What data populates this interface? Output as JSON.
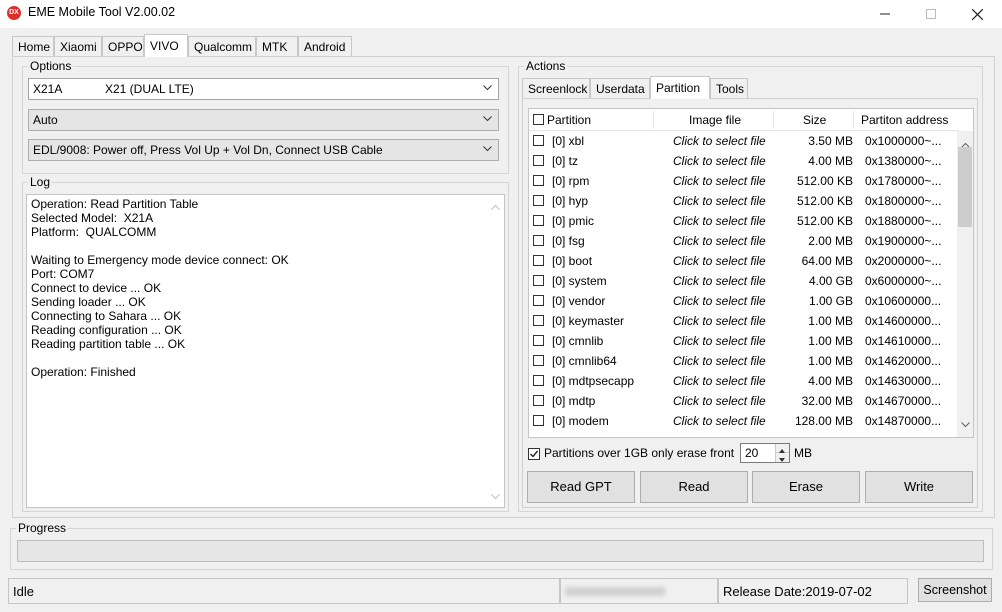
{
  "window": {
    "title": "EME Mobile Tool V2.00.02",
    "icon": "app-logo-icon",
    "icon_text": "DX"
  },
  "main_tabs": [
    {
      "label": "Home"
    },
    {
      "label": "Xiaomi"
    },
    {
      "label": "OPPO"
    },
    {
      "label": "VIVO"
    },
    {
      "label": "Qualcomm"
    },
    {
      "label": "MTK"
    },
    {
      "label": "Android"
    }
  ],
  "main_tabs_active": "VIVO",
  "options": {
    "label": "Options",
    "model_code": "X21A",
    "model_name": "X21 (DUAL LTE)",
    "mode": "Auto",
    "connect": "EDL/9008: Power off, Press Vol Up + Vol Dn, Connect USB Cable"
  },
  "log": {
    "label": "Log",
    "lines": [
      "Operation: Read Partition Table",
      "Selected Model:  X21A",
      "Platform:  QUALCOMM",
      "",
      "Waiting to Emergency mode device connect: OK",
      "Port: COM7",
      "Connect to device ... OK",
      "Sending loader ... OK",
      "Connecting to Sahara ... OK",
      "Reading configuration ... OK",
      "Reading partition table ... OK",
      "",
      "Operation: Finished"
    ]
  },
  "actions": {
    "label": "Actions",
    "tabs": [
      {
        "label": "Screenlock"
      },
      {
        "label": "Userdata"
      },
      {
        "label": "Partition"
      },
      {
        "label": "Tools"
      }
    ],
    "active_tab": "Partition",
    "table": {
      "headers": {
        "partition": "Partition",
        "image": "Image file",
        "size": "Size",
        "address": "Partiton address"
      },
      "rows": [
        {
          "name": "[0] xbl",
          "image": "Click to select file",
          "size": "3.50 MB",
          "address": "0x1000000~..."
        },
        {
          "name": "[0] tz",
          "image": "Click to select file",
          "size": "4.00 MB",
          "address": "0x1380000~..."
        },
        {
          "name": "[0] rpm",
          "image": "Click to select file",
          "size": "512.00 KB",
          "address": "0x1780000~..."
        },
        {
          "name": "[0] hyp",
          "image": "Click to select file",
          "size": "512.00 KB",
          "address": "0x1800000~..."
        },
        {
          "name": "[0] pmic",
          "image": "Click to select file",
          "size": "512.00 KB",
          "address": "0x1880000~..."
        },
        {
          "name": "[0] fsg",
          "image": "Click to select file",
          "size": "2.00 MB",
          "address": "0x1900000~..."
        },
        {
          "name": "[0] boot",
          "image": "Click to select file",
          "size": "64.00 MB",
          "address": "0x2000000~..."
        },
        {
          "name": "[0] system",
          "image": "Click to select file",
          "size": "4.00 GB",
          "address": "0x6000000~..."
        },
        {
          "name": "[0] vendor",
          "image": "Click to select file",
          "size": "1.00 GB",
          "address": "0x10600000..."
        },
        {
          "name": "[0] keymaster",
          "image": "Click to select file",
          "size": "1.00 MB",
          "address": "0x14600000..."
        },
        {
          "name": "[0] cmnlib",
          "image": "Click to select file",
          "size": "1.00 MB",
          "address": "0x14610000..."
        },
        {
          "name": "[0] cmnlib64",
          "image": "Click to select file",
          "size": "1.00 MB",
          "address": "0x14620000..."
        },
        {
          "name": "[0] mdtpsecapp",
          "image": "Click to select file",
          "size": "4.00 MB",
          "address": "0x14630000..."
        },
        {
          "name": "[0] mdtp",
          "image": "Click to select file",
          "size": "32.00 MB",
          "address": "0x14670000..."
        },
        {
          "name": "[0] modem",
          "image": "Click to select file",
          "size": "128.00 MB",
          "address": "0x14870000..."
        }
      ]
    },
    "erase_option": {
      "label": "Partitions over 1GB only erase front",
      "value": "20",
      "unit": "MB",
      "checked": true
    },
    "buttons": {
      "read_gpt": "Read GPT",
      "read": "Read",
      "erase": "Erase",
      "write": "Write"
    }
  },
  "progress": {
    "label": "Progress",
    "value": 0
  },
  "status": {
    "state": "Idle",
    "release": "Release Date:2019-07-02",
    "screenshot_button": "Screenshot"
  }
}
